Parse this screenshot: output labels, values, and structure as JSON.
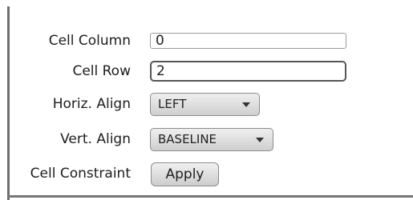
{
  "form": {
    "cell_column": {
      "label": "Cell Column",
      "value": "0"
    },
    "cell_row": {
      "label": "Cell Row",
      "value": "2"
    },
    "horiz_align": {
      "label": "Horiz. Align",
      "selected": "LEFT"
    },
    "vert_align": {
      "label": "Vert. Align",
      "selected": "BASELINE"
    },
    "cell_constraint": {
      "label": "Cell Constraint",
      "button_label": "Apply"
    }
  },
  "icons": {
    "dropdown": "chevron-down-icon"
  },
  "colors": {
    "border": "#777777",
    "field_border": "#9a9a9a",
    "focused_border": "#555555",
    "button_gradient_top": "#f0f0f0",
    "button_gradient_bottom": "#cdcdcd"
  }
}
